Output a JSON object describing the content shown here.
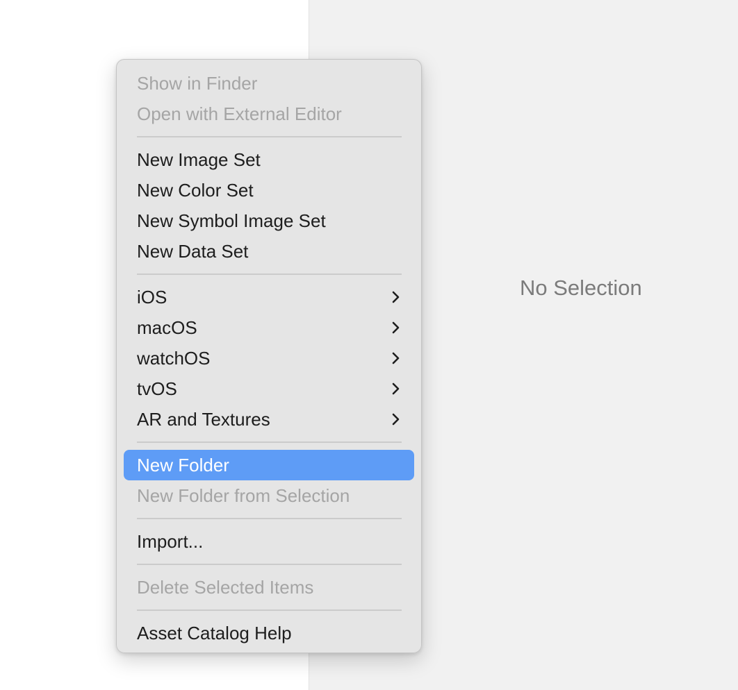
{
  "detail": {
    "placeholder": "No Selection"
  },
  "context_menu": {
    "groups": [
      {
        "items": [
          {
            "label": "Show in Finder",
            "enabled": false
          },
          {
            "label": "Open with External Editor",
            "enabled": false
          }
        ]
      },
      {
        "items": [
          {
            "label": "New Image Set",
            "enabled": true
          },
          {
            "label": "New Color Set",
            "enabled": true
          },
          {
            "label": "New Symbol Image Set",
            "enabled": true
          },
          {
            "label": "New Data Set",
            "enabled": true
          }
        ]
      },
      {
        "items": [
          {
            "label": "iOS",
            "enabled": true,
            "submenu": true
          },
          {
            "label": "macOS",
            "enabled": true,
            "submenu": true
          },
          {
            "label": "watchOS",
            "enabled": true,
            "submenu": true
          },
          {
            "label": "tvOS",
            "enabled": true,
            "submenu": true
          },
          {
            "label": "AR and Textures",
            "enabled": true,
            "submenu": true
          }
        ]
      },
      {
        "items": [
          {
            "label": "New Folder",
            "enabled": true,
            "highlighted": true
          },
          {
            "label": "New Folder from Selection",
            "enabled": false
          }
        ]
      },
      {
        "items": [
          {
            "label": "Import...",
            "enabled": true
          }
        ]
      },
      {
        "items": [
          {
            "label": "Delete Selected Items",
            "enabled": false
          }
        ]
      },
      {
        "items": [
          {
            "label": "Asset Catalog Help",
            "enabled": true
          }
        ]
      }
    ],
    "highlight_color": "#5e9cf6",
    "disabled_text_color": "#a5a5a5",
    "submenu_icon": "chevron-right-icon"
  }
}
